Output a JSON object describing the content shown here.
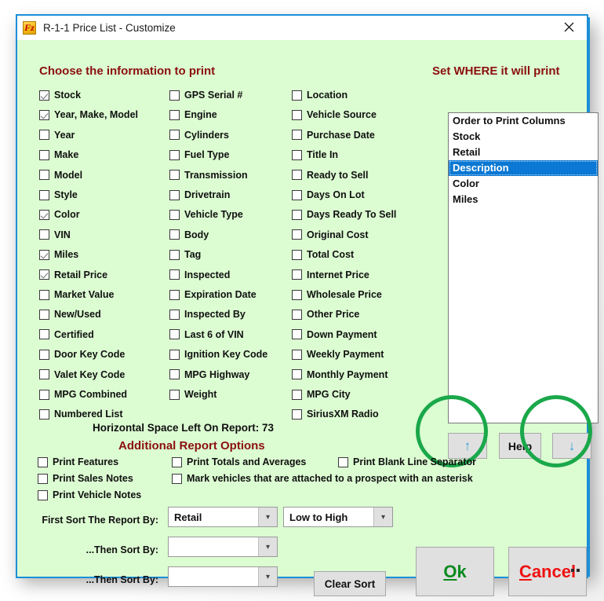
{
  "window": {
    "title": "R-1-1 Price List - Customize",
    "icon": "fz-app-icon",
    "close_icon": "close-icon",
    "border_color": "#1b8fd8",
    "client_bg": "#dcfcd2"
  },
  "headings": {
    "choose": "Choose the information to print",
    "set_where": "Set WHERE it will print",
    "additional": "Additional Report Options"
  },
  "columns": {
    "col1": [
      {
        "label": "Stock",
        "checked": true
      },
      {
        "label": "Year, Make, Model",
        "checked": true
      },
      {
        "label": "Year",
        "checked": false
      },
      {
        "label": "Make",
        "checked": false
      },
      {
        "label": "Model",
        "checked": false
      },
      {
        "label": "Style",
        "checked": false
      },
      {
        "label": "Color",
        "checked": true
      },
      {
        "label": "VIN",
        "checked": false
      },
      {
        "label": "Miles",
        "checked": true
      },
      {
        "label": "Retail Price",
        "checked": true
      },
      {
        "label": "Market Value",
        "checked": false
      },
      {
        "label": "New/Used",
        "checked": false
      },
      {
        "label": "Certified",
        "checked": false
      },
      {
        "label": "Door Key Code",
        "checked": false
      },
      {
        "label": "Valet Key Code",
        "checked": false
      },
      {
        "label": "MPG Combined",
        "checked": false
      },
      {
        "label": "Numbered List",
        "checked": false
      }
    ],
    "col2": [
      {
        "label": "GPS Serial #",
        "checked": false
      },
      {
        "label": "Engine",
        "checked": false
      },
      {
        "label": "Cylinders",
        "checked": false
      },
      {
        "label": "Fuel Type",
        "checked": false
      },
      {
        "label": "Transmission",
        "checked": false
      },
      {
        "label": "Drivetrain",
        "checked": false
      },
      {
        "label": "Vehicle Type",
        "checked": false
      },
      {
        "label": "Body",
        "checked": false
      },
      {
        "label": "Tag",
        "checked": false
      },
      {
        "label": "Inspected",
        "checked": false
      },
      {
        "label": "Expiration Date",
        "checked": false
      },
      {
        "label": "Inspected By",
        "checked": false
      },
      {
        "label": "Last 6 of VIN",
        "checked": false
      },
      {
        "label": "Ignition Key Code",
        "checked": false
      },
      {
        "label": "MPG Highway",
        "checked": false
      },
      {
        "label": "Weight",
        "checked": false
      }
    ],
    "col3": [
      {
        "label": "Location",
        "checked": false
      },
      {
        "label": "Vehicle Source",
        "checked": false
      },
      {
        "label": "Purchase Date",
        "checked": false
      },
      {
        "label": "Title In",
        "checked": false
      },
      {
        "label": "Ready to Sell",
        "checked": false
      },
      {
        "label": "Days On Lot",
        "checked": false
      },
      {
        "label": "Days Ready To Sell",
        "checked": false
      },
      {
        "label": "Original Cost",
        "checked": false
      },
      {
        "label": "Total Cost",
        "checked": false
      },
      {
        "label": "Internet Price",
        "checked": false
      },
      {
        "label": "Wholesale Price",
        "checked": false
      },
      {
        "label": "Other Price",
        "checked": false
      },
      {
        "label": "Down Payment",
        "checked": false
      },
      {
        "label": "Weekly Payment",
        "checked": false
      },
      {
        "label": "Monthly Payment",
        "checked": false
      },
      {
        "label": "MPG City",
        "checked": false
      },
      {
        "label": "SiriusXM Radio",
        "checked": false
      }
    ]
  },
  "print_order_list": {
    "items": [
      {
        "label": "Order to Print Columns",
        "selected": false
      },
      {
        "label": "Stock",
        "selected": false
      },
      {
        "label": "Retail",
        "selected": false
      },
      {
        "label": "Description",
        "selected": true
      },
      {
        "label": "Color",
        "selected": false
      },
      {
        "label": "Miles",
        "selected": false
      }
    ],
    "selected_color": "#0a78d4"
  },
  "order_buttons": {
    "move_up": "↑",
    "move_down": "↓",
    "help": "Help",
    "highlight_color": "#1aa84a"
  },
  "space_left": "Horizontal Space Left On Report: 73",
  "additional_options": [
    {
      "label": "Print Features",
      "checked": false
    },
    {
      "label": "Print Sales Notes",
      "checked": false
    },
    {
      "label": "Print Vehicle Notes",
      "checked": false
    },
    {
      "label": "Print Totals and Averages",
      "checked": false
    },
    {
      "label": "Mark vehicles that are attached to a prospect with an asterisk",
      "checked": false
    },
    {
      "label": "Print Blank Line Separator",
      "checked": false
    }
  ],
  "sort": {
    "label1": "First Sort The Report By:",
    "label2": "...Then Sort By:",
    "label3": "...Then Sort By:",
    "sort_field_1": "Retail",
    "sort_field_2": "",
    "sort_field_3": "",
    "direction": "Low to High",
    "dropdown_icon": "chevron-down-icon",
    "clear_button": "Clear Sort"
  },
  "actions": {
    "ok_accel": "O",
    "ok_rest": "k",
    "cancel_accel": "C",
    "cancel_rest": "ancel",
    "ok_color": "#0a8a1e",
    "cancel_color": "#ef1111"
  }
}
